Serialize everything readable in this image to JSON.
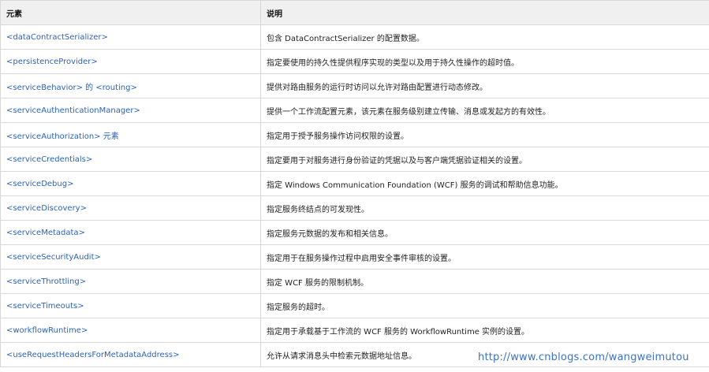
{
  "table": {
    "headers": {
      "element": "元素",
      "description": "说明"
    },
    "rows": [
      {
        "element": "<dataContractSerializer>",
        "description": "包含 DataContractSerializer 的配置数据。"
      },
      {
        "element": "<persistenceProvider>",
        "description": "指定要使用的持久性提供程序实现的类型以及用于持久性操作的超时值。"
      },
      {
        "element": "<serviceBehavior> 的 <routing>",
        "description": "提供对路由服务的运行时访问以允许对路由配置进行动态修改。"
      },
      {
        "element": "<serviceAuthenticationManager>",
        "description": "提供一个工作流配置元素，该元素在服务级别建立传输、消息或发起方的有效性。"
      },
      {
        "element": "<serviceAuthorization> 元素",
        "description": "指定用于授予服务操作访问权限的设置。"
      },
      {
        "element": "<serviceCredentials>",
        "description": "指定要用于对服务进行身份验证的凭据以及与客户端凭据验证相关的设置。"
      },
      {
        "element": "<serviceDebug>",
        "description": "指定 Windows Communication Foundation (WCF) 服务的调试和帮助信息功能。"
      },
      {
        "element": "<serviceDiscovery>",
        "description": "指定服务终结点的可发现性。"
      },
      {
        "element": "<serviceMetadata>",
        "description": "指定服务元数据的发布和相关信息。"
      },
      {
        "element": "<serviceSecurityAudit>",
        "description": "指定用于在服务操作过程中启用安全事件审核的设置。"
      },
      {
        "element": "<serviceThrottling>",
        "description": "指定 WCF 服务的限制机制。"
      },
      {
        "element": "<serviceTimeouts>",
        "description": "指定服务的超时。"
      },
      {
        "element": "<workflowRuntime>",
        "description": "指定用于承载基于工作流的 WCF 服务的 WorkflowRuntime 实例的设置。"
      },
      {
        "element": "<useRequestHeadersForMetadataAddress>",
        "description": "允许从请求消息头中检索元数据地址信息。"
      }
    ]
  },
  "watermark": "http://www.cnblogs.com/wangweimutou"
}
